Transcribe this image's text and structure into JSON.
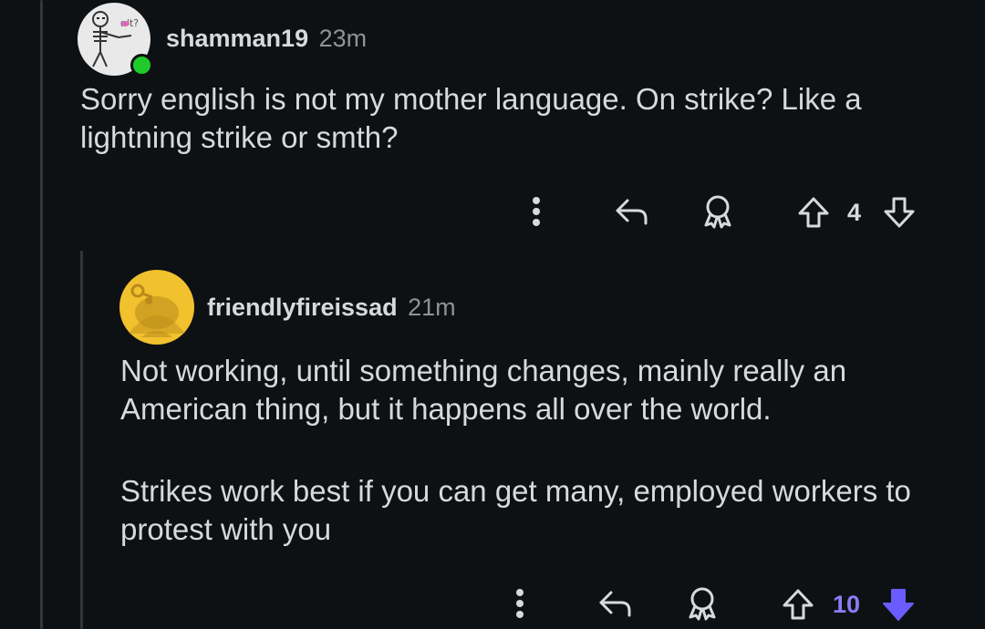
{
  "comments": [
    {
      "username": "shamman19",
      "age": "23m",
      "text": "Sorry english is not my mother language. On strike? Like a lightning strike or smth?",
      "avatar_caption": "n't?",
      "online": true,
      "score": "4",
      "vote_state": "none",
      "icons": [
        "more-options-icon",
        "reply-icon",
        "award-icon",
        "upvote-icon",
        "downvote-icon"
      ]
    },
    {
      "username": "friendlyfireissad",
      "age": "21m",
      "paragraphs": [
        "Not working, until something changes, mainly really an American thing, but it happens all over the world.",
        "Strikes work best if you can get many, employed workers to protest with you"
      ],
      "score": "10",
      "vote_state": "downvoted",
      "icons": [
        "more-options-icon",
        "reply-icon",
        "award-icon",
        "upvote-icon",
        "downvote-icon"
      ]
    }
  ],
  "colors": {
    "background": "#0e1113",
    "text": "#d7dadc",
    "muted": "#8f9396",
    "online": "#1fcb2a",
    "snoo_avatar": "#f2c12e",
    "downvote_active": "#6a5cff"
  }
}
